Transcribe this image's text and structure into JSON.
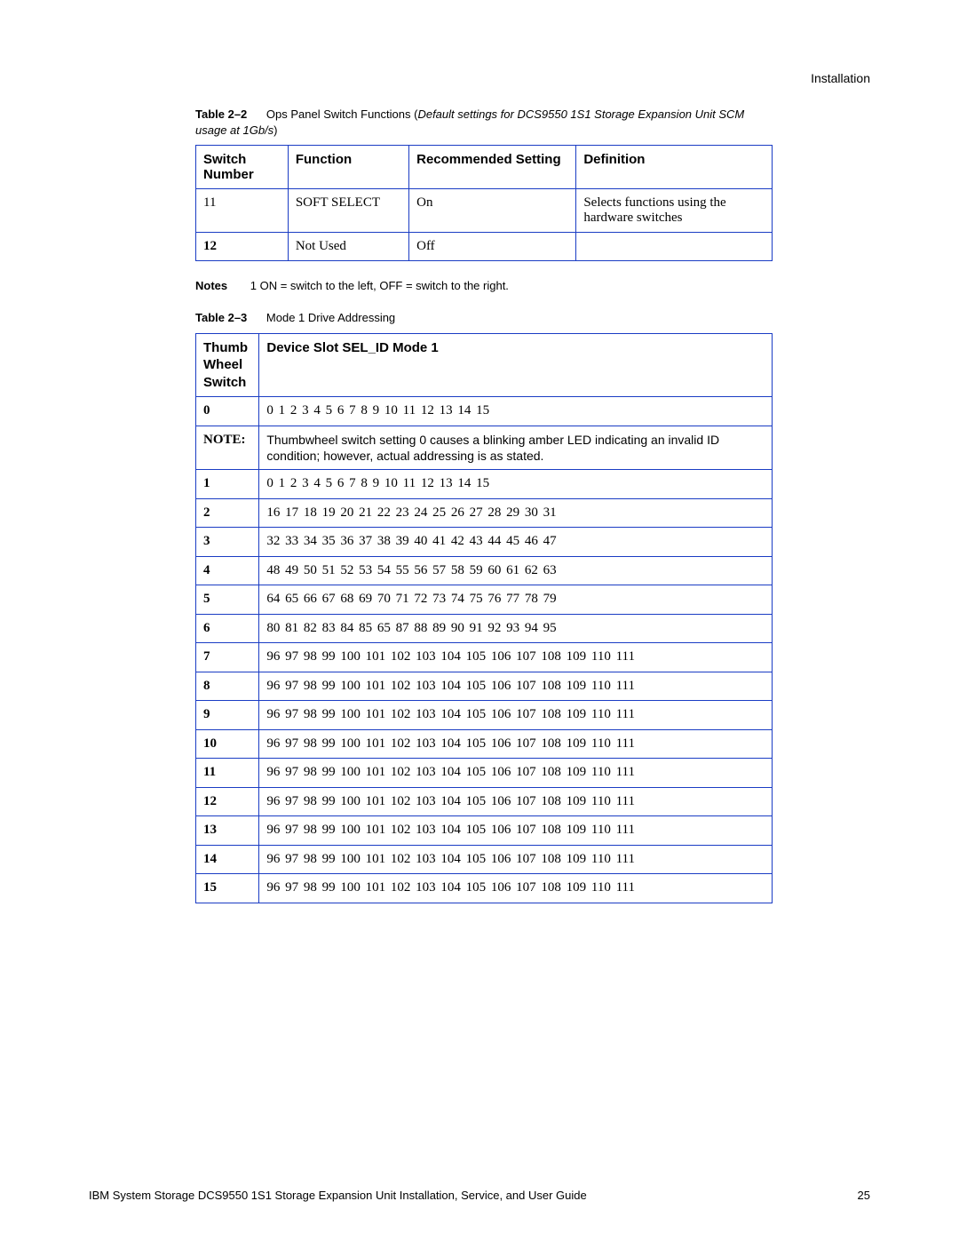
{
  "header": {
    "running": "Installation"
  },
  "captions": {
    "t22_label": "Table 2–2",
    "t22_text_a": "Ops Panel Switch Functions (",
    "t22_text_b": "Default settings for DCS9550 1S1 Storage Expansion Unit SCM usage at 1Gb/s",
    "t22_text_c": ")",
    "t23_label": "Table 2–3",
    "t23_text": "Mode 1 Drive Addressing"
  },
  "table22": {
    "headers": [
      "Switch Number",
      "Function",
      "Recommended Setting",
      "Definition"
    ],
    "rows": [
      [
        "11",
        "SOFT SELECT",
        "On",
        "Selects functions using the hardware switches"
      ],
      [
        "12",
        "Not Used",
        "Off",
        ""
      ]
    ]
  },
  "notes": {
    "label": "Notes",
    "text": "1 ON = switch to the left, OFF = switch to the right."
  },
  "table23": {
    "head_left": "Thumb Wheel Switch",
    "head_right": "Device Slot SEL_ID Mode 1",
    "note_label": "NOTE:",
    "note_text": "Thumbwheel switch setting 0 causes a blinking amber LED indicating an invalid ID condition; however, actual addressing is as stated.",
    "rows": [
      {
        "l": "0",
        "v": "0   1   2   3   4   5   6   7   8   9   10   11   12   13   14   15"
      },
      {
        "l": "1",
        "v": "0   1   2   3   4   5   6   7   8   9   10   11   12   13   14   15"
      },
      {
        "l": "2",
        "v": "16  17  18   19  20   21  22   23  24   25   26   27   28   29   30   31"
      },
      {
        "l": "3",
        "v": "32  33  34   35  36  37  38   39   40   41   42   43   44   45   46   47"
      },
      {
        "l": "4",
        "v": "48  49  50   51  52  53  54   55   56   57   58   59   60   61   62   63"
      },
      {
        "l": "5",
        "v": "64  65  66   67  68   69  70   71   72   73   74   75   76   77   78   79"
      },
      {
        "l": "6",
        "v": "80   81  82   83  84  85   65   87   88   89   90   91   92   93   94   95"
      },
      {
        "l": "7",
        "v": "96   97  98   99 100 101  102 103  104 105 106 107 108  109 110  111"
      },
      {
        "l": "8",
        "v": "96   97  98   99 100 101  102 103  104 105 106 107 108  109 110  111"
      },
      {
        "l": "9",
        "v": "96   97  98   99 100 101  102 103  104 105 106 107 108  109 110  111"
      },
      {
        "l": "10",
        "v": "96   97  98   99 100 101  102 103  104 105 106 107 108  109 110  111"
      },
      {
        "l": "11",
        "v": "96   97  98   99 100 101  102 103  104 105 106 107 108  109 110  111"
      },
      {
        "l": "12",
        "v": "96   97  98   99 100 101  102 103  104 105 106 107 108  109 110  111"
      },
      {
        "l": "13",
        "v": "96   97  98   99 100 101  102 103  104 105 106 107 108  109 110  111"
      },
      {
        "l": "14",
        "v": "96   97  98   99 100 101  102 103  104 105 106 107 108  109 110  111"
      },
      {
        "l": "15",
        "v": "96   97  98   99 100 101  102 103  104 105 106 107 108  109 110  111"
      }
    ]
  },
  "footer": {
    "title": "IBM System Storage DCS9550 1S1 Storage Expansion Unit Installation, Service, and User Guide",
    "page": "25"
  }
}
